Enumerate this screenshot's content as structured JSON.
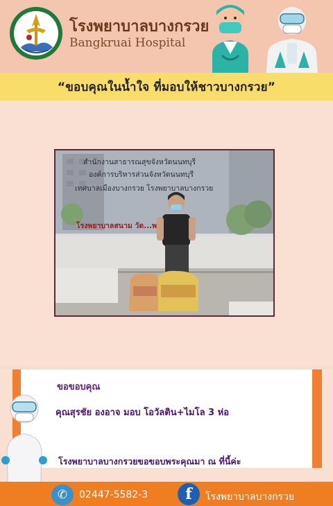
{
  "header": {
    "hospital_name_th": "โรงพยาบาลบางกรวย",
    "hospital_name_en": "Bangkruai Hospital"
  },
  "banner": {
    "text": "“ขอบคุณในน้ำใจ ที่มอบให้ชาวบางกรวย”"
  },
  "photo": {
    "sign_lines": [
      "สำนักงานสาธารณสุขจังหวัดนนทบุรี",
      "องค์การบริหารส่วนจังหวัดนนทบุรี",
      "เทศบาลเมืองบางกรวย โรงพยาบาลบางกรวย",
      "โรงพยาบาลสนาม วัด...พรหม"
    ]
  },
  "card": {
    "title": "ขอขอบคุณ",
    "donation_line": "คุณสุรชัย องอาจ มอบ โอวัลติน+ไมโล 3 ห่อ",
    "footer_line": "โรงพยาบาลบางกรวยขอขอบพระคุณมา ณ ที่นี้ค่ะ"
  },
  "footer": {
    "phone": "02447-5582-3",
    "facebook_page": "โรงพยาบาลบางกรวย"
  },
  "icons": {
    "phone": "phone-icon",
    "facebook": "facebook-icon"
  },
  "colors": {
    "accent_orange": "#ef7d22",
    "banner_yellow": "#f9dd6a",
    "text_purple": "#4a1470"
  }
}
